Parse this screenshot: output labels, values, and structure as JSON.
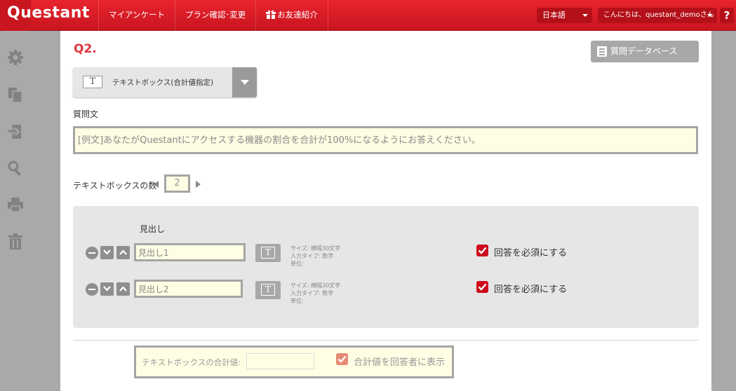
{
  "header": {
    "logo": "Questant",
    "nav": [
      {
        "label": "マイアンケート"
      },
      {
        "label": "プラン確認･変更"
      },
      {
        "label": "お友達紹介"
      }
    ],
    "language": "日本語",
    "greeting": "こんにちは、questant_demoさん",
    "help": "?"
  },
  "sidebar": {
    "icons": [
      "gear-icon",
      "copy-icon",
      "shuffle-icon",
      "search-icon",
      "print-icon",
      "trash-icon"
    ]
  },
  "question": {
    "number": "Q2.",
    "db_button": "質問データベース",
    "type_label": "テキストボックス(合計値指定)",
    "text_label": "質問文",
    "text_placeholder": "[例文]あなたがQuestantにアクセスする機器の割合を合計が100%になるようにお答えください。"
  },
  "textbox_count": {
    "label": "テキストボックスの数",
    "value": "2"
  },
  "rows_header": "見出し",
  "rows": [
    {
      "value": "見出し1",
      "size": "サイズ: 横幅30文字",
      "input_type": "入力タイプ: 数字",
      "unit": "単位:",
      "required_label": "回答を必須にする"
    },
    {
      "value": "見出し2",
      "size": "サイズ: 横幅30文字",
      "input_type": "入力タイプ: 数字",
      "unit": "単位:",
      "required_label": "回答を必須にする"
    }
  ],
  "sum": {
    "label": "テキストボックスの合計値:",
    "show_label": "合計値を回答者に表示"
  },
  "colors": {
    "brand_red": "#d81c26",
    "required_check": "#cc0b1d",
    "input_bg": "#fffde3"
  }
}
